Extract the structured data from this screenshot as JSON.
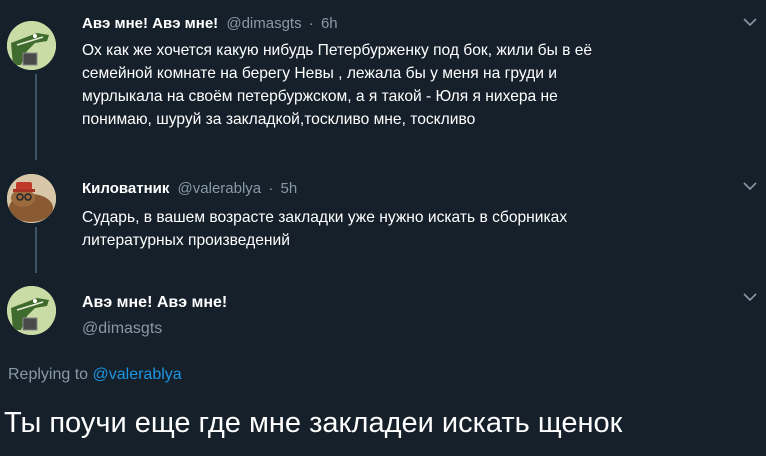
{
  "tweets": [
    {
      "name": "Авэ мне! Авэ мне!",
      "handle": "@dimasgts",
      "separator": "·",
      "time": "6h",
      "text": "Ох как же хочется какую нибудь Петербурженку  под бок, жили бы в её\nсемейной комнате на берегу Невы , лежала бы у меня на груди и\nмурлыкала на своём петербуржском, а я такой - Юля я нихера не\nпонимаю, шуруй за  закладкой,тоскливо мне, тоскливо",
      "avatar_icon": "crocodile-avatar-icon",
      "menu_icon": "chevron-down-icon"
    },
    {
      "name": "Киловатник",
      "handle": "@valerablya",
      "separator": "·",
      "time": "5h",
      "text": "Сударь, в вашем возрасте закладки уже нужно искать в сборниках\nлитературных произведений",
      "avatar_icon": "capybara-avatar-icon",
      "menu_icon": "chevron-down-icon"
    }
  ],
  "main_tweet": {
    "name": "Авэ мне! Авэ мне!",
    "handle": "@dimasgts",
    "avatar_icon": "crocodile-avatar-icon",
    "menu_icon": "chevron-down-icon",
    "replying_prefix": "Replying to ",
    "replying_mention": "@valerablya",
    "text": "Ты поучи еще где мне закладеи искать щенок"
  },
  "colors": {
    "background": "#15202b",
    "secondary_text": "#8899a6",
    "link": "#1b95e0",
    "thread_line": "#3d5466"
  }
}
